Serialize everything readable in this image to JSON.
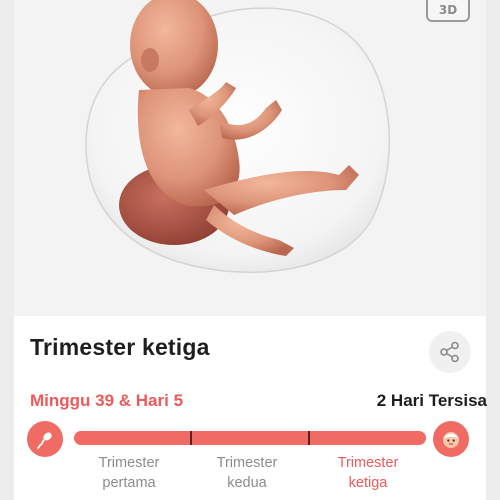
{
  "hero": {
    "badge_3d": "3D",
    "illustration": "fetus-3d-image"
  },
  "header": {
    "title": "Trimester ketiga"
  },
  "progress": {
    "week_text": "Minggu 39 & Hari 5",
    "remaining_text": "2 Hari Tersisa",
    "start_icon": "sperm-icon",
    "end_icon": "baby-face-icon",
    "trimesters": [
      {
        "line1": "Trimester",
        "line2": "pertama",
        "active": false
      },
      {
        "line1": "Trimester",
        "line2": "kedua",
        "active": false
      },
      {
        "line1": "Trimester",
        "line2": "ketiga",
        "active": true
      }
    ]
  },
  "colors": {
    "accent": "#ef6b64",
    "accent_text": "#ec5a5a",
    "muted_text": "#8c8c8c",
    "title_text": "#1e1e1e"
  }
}
